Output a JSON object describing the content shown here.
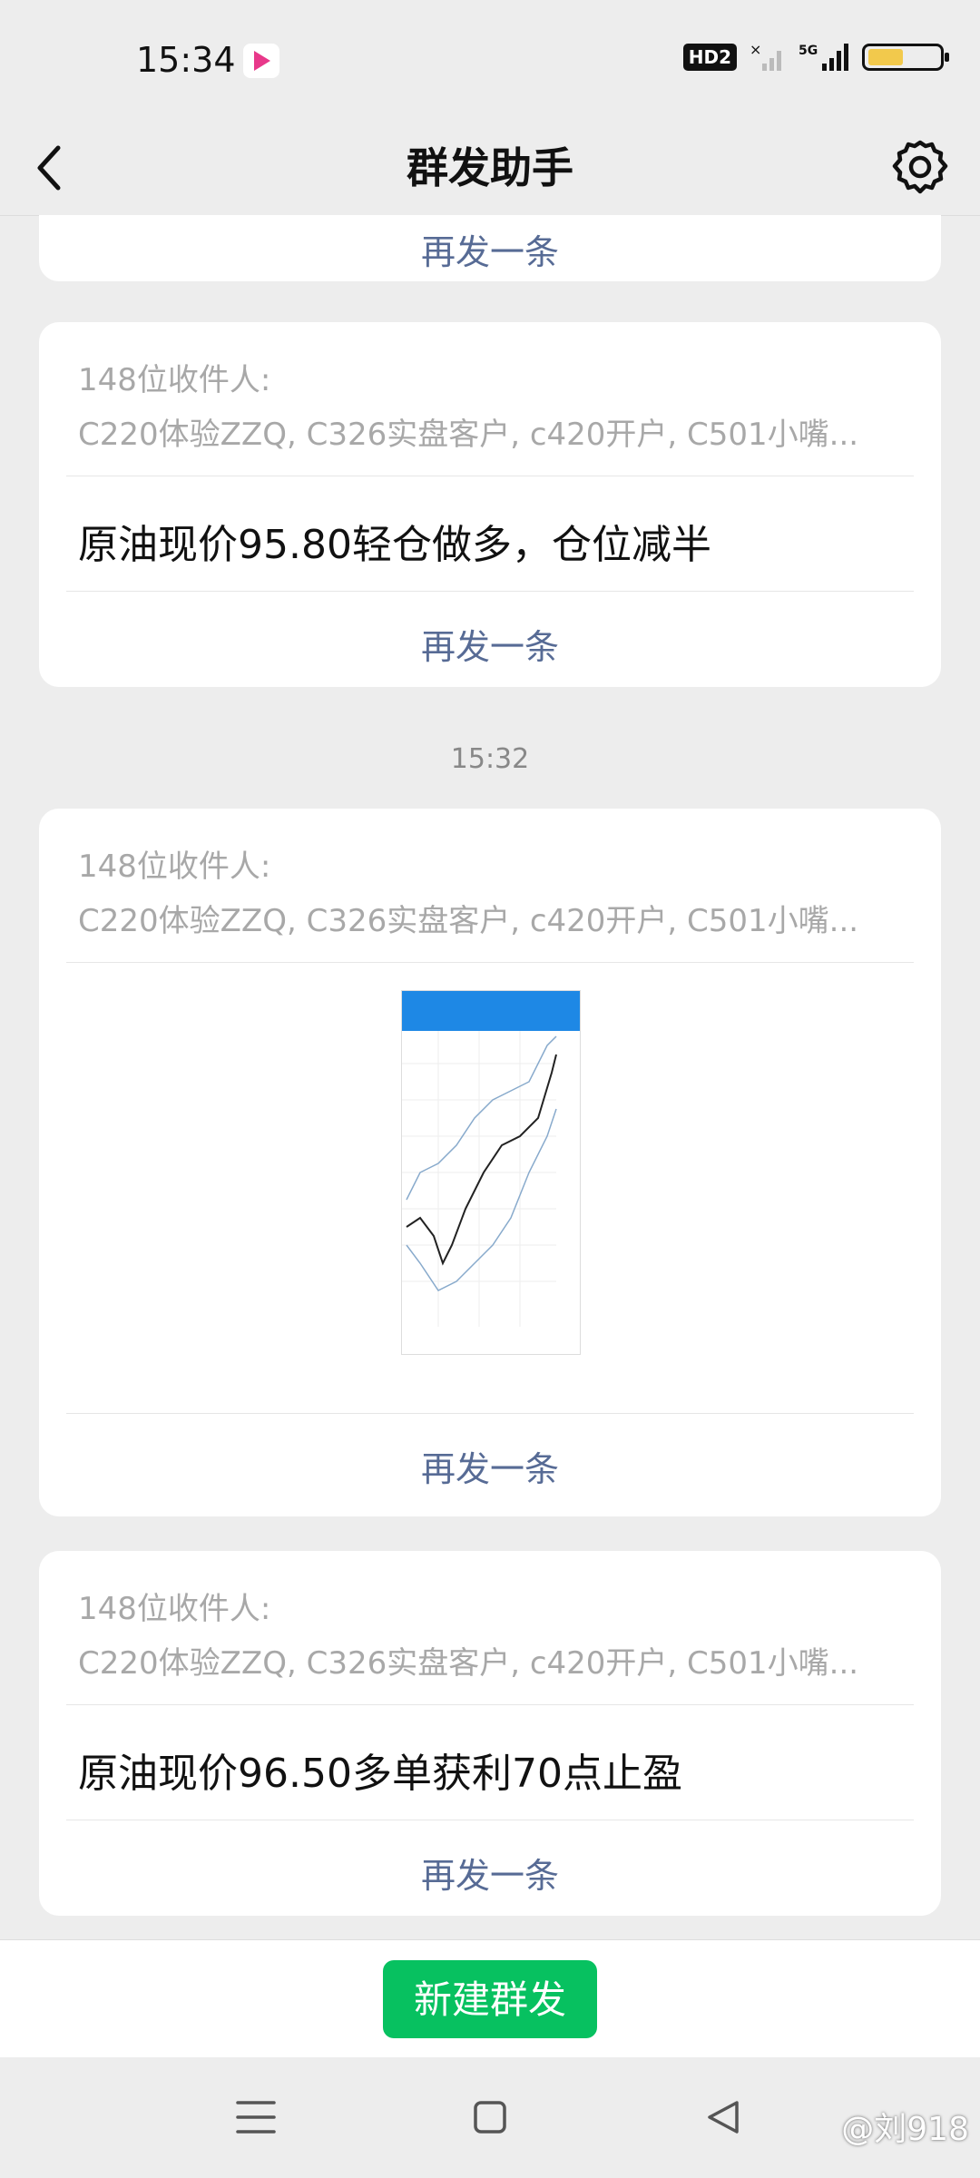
{
  "status": {
    "time": "15:34",
    "hd": "HD2",
    "net": "5G"
  },
  "header": {
    "title": "群发助手"
  },
  "messages": [
    {
      "resend": "再发一条"
    },
    {
      "recipients_label": "148位收件人:",
      "recipients": "C220体验ZZQ, C326实盘客户, c420开户, C501小嘴...",
      "text": "原油现价95.80轻仓做多，仓位减半",
      "resend": "再发一条"
    },
    {
      "timestamp": "15:32"
    },
    {
      "recipients_label": "148位收件人:",
      "recipients": "C220体验ZZQ, C326实盘客户, c420开户, C501小嘴...",
      "image": "chart-screenshot",
      "resend": "再发一条"
    },
    {
      "recipients_label": "148位收件人:",
      "recipients": "C220体验ZZQ, C326实盘客户, c420开户, C501小嘴...",
      "text": "原油现价96.50多单获利70点止盈",
      "resend": "再发一条"
    }
  ],
  "footer": {
    "new_broadcast": "新建群发"
  },
  "watermark": "@刘918",
  "icons": {
    "back": "back-arrow-icon",
    "settings": "gear-icon",
    "menu": "menu-icon",
    "home": "home-icon",
    "recent": "back-triangle-icon"
  },
  "colors": {
    "accent": "#07C160",
    "link": "#576B95",
    "background": "#EDEDED"
  }
}
